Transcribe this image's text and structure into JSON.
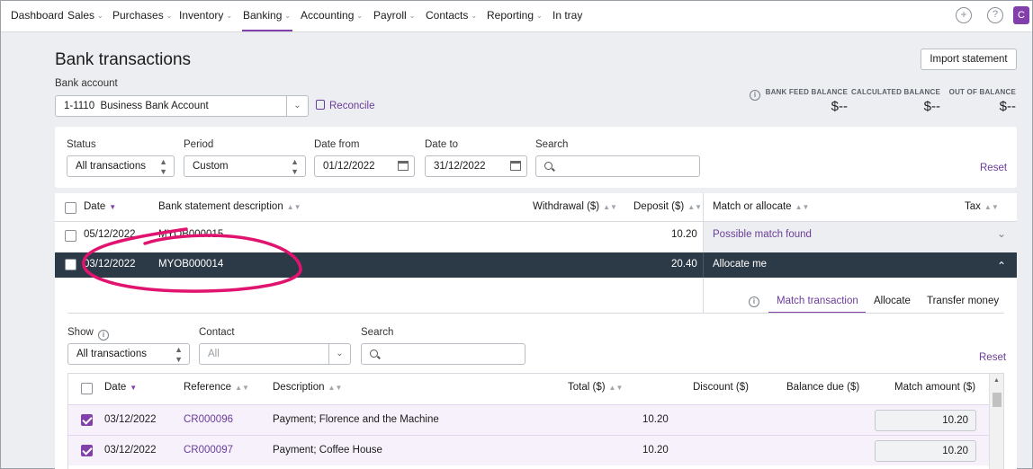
{
  "nav": {
    "items": [
      {
        "label": "Dashboard",
        "chevron": false
      },
      {
        "label": "Sales",
        "chevron": true
      },
      {
        "label": "Purchases",
        "chevron": true
      },
      {
        "label": "Inventory",
        "chevron": true
      },
      {
        "label": "Banking",
        "chevron": true,
        "active": true
      },
      {
        "label": "Accounting",
        "chevron": true
      },
      {
        "label": "Payroll",
        "chevron": true
      },
      {
        "label": "Contacts",
        "chevron": true
      },
      {
        "label": "Reporting",
        "chevron": true
      },
      {
        "label": "In tray",
        "chevron": false
      }
    ],
    "avatar": "C",
    "add_icon": "+",
    "help_icon": "?"
  },
  "page": {
    "title": "Bank transactions",
    "import_button": "Import statement",
    "bank_account_label": "Bank account",
    "bank_account_value": "1-1110  Business Bank Account",
    "reconcile_link": "Reconcile"
  },
  "balances": {
    "bank_feed": {
      "caption": "BANK FEED BALANCE",
      "value": "$--"
    },
    "calculated": {
      "caption": "CALCULATED BALANCE",
      "value": "$--"
    },
    "out_of": {
      "caption": "OUT OF BALANCE",
      "value": "$--"
    }
  },
  "filters": {
    "status_label": "Status",
    "status_value": "All transactions",
    "period_label": "Period",
    "period_value": "Custom",
    "date_from_label": "Date from",
    "date_from_value": "01/12/2022",
    "date_to_label": "Date to",
    "date_to_value": "31/12/2022",
    "search_label": "Search",
    "search_value": "",
    "reset": "Reset"
  },
  "table": {
    "headers": {
      "date": "Date",
      "description": "Bank statement description",
      "withdrawal": "Withdrawal ($)",
      "deposit": "Deposit ($)",
      "match": "Match or allocate",
      "tax": "Tax"
    },
    "rows": [
      {
        "date": "05/12/2022",
        "description": "MYOB000015",
        "withdrawal": "",
        "deposit": "10.20",
        "match": "Possible match found"
      },
      {
        "date": "03/12/2022",
        "description": "MYOB000014",
        "withdrawal": "",
        "deposit": "20.40",
        "match": "Allocate me"
      }
    ]
  },
  "detail": {
    "tabs": [
      "Match transaction",
      "Allocate",
      "Transfer money"
    ],
    "active_tab": "Match transaction",
    "show_label": "Show",
    "show_value": "All transactions",
    "contact_label": "Contact",
    "contact_placeholder": "All",
    "search_label": "Search",
    "search_value": "",
    "reset": "Reset",
    "headers": {
      "date": "Date",
      "reference": "Reference",
      "description": "Description",
      "total": "Total ($)",
      "discount": "Discount ($)",
      "balance_due": "Balance due ($)",
      "match_amount": "Match amount ($)"
    },
    "rows": [
      {
        "checked": true,
        "date": "03/12/2022",
        "reference": "CR000096",
        "description": "Payment; Florence and the Machine",
        "total": "10.20",
        "discount": "",
        "balance_due": "",
        "match_amount": "10.20"
      },
      {
        "checked": true,
        "date": "03/12/2022",
        "reference": "CR000097",
        "description": "Payment; Coffee House",
        "total": "10.20",
        "discount": "",
        "balance_due": "",
        "match_amount": "10.20"
      }
    ]
  },
  "colors": {
    "accent": "#8241aa",
    "selected_row": "#2c3947",
    "annotation": "#e0136f"
  }
}
